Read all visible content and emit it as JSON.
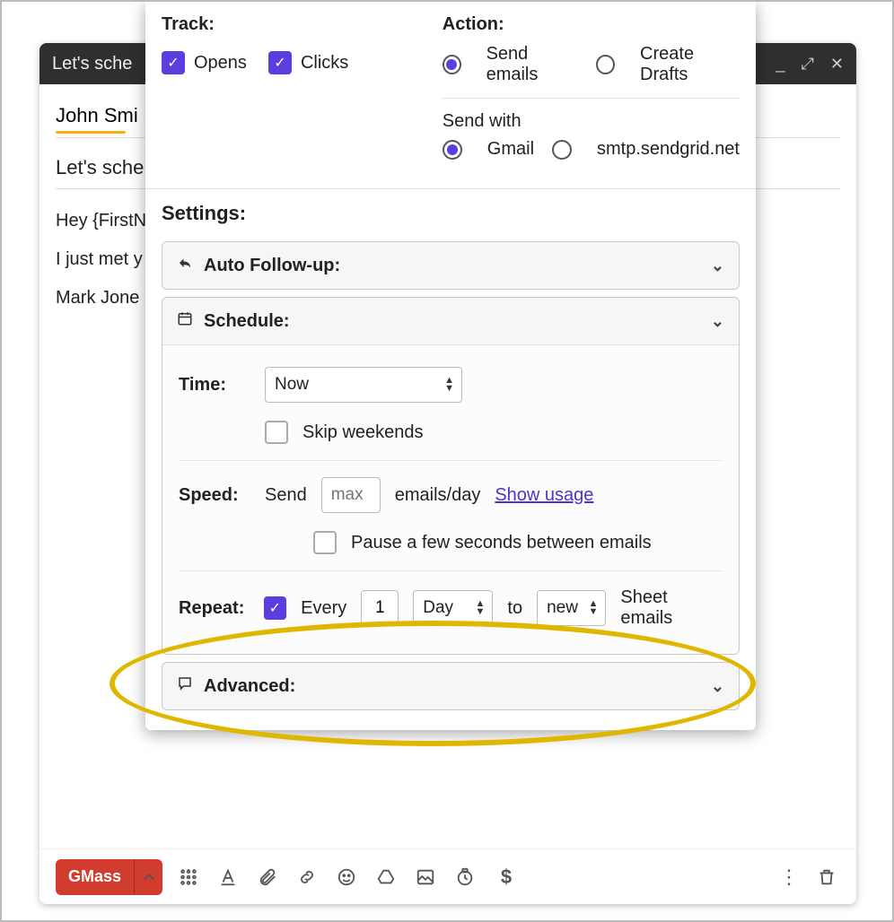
{
  "compose": {
    "subject_title": "Let's sche",
    "recipient": "John Smi",
    "subject": "Let's sche",
    "body_line1": "Hey {FirstN",
    "body_line2": "I just met y",
    "body_line3": "Mark Jone"
  },
  "panel": {
    "track_label": "Track:",
    "track_opens": "Opens",
    "track_clicks": "Clicks",
    "action_label": "Action:",
    "action_send": "Send emails",
    "action_drafts": "Create Drafts",
    "sendwith_label": "Send with",
    "sendwith_gmail": "Gmail",
    "sendwith_smtp": "smtp.sendgrid.net",
    "settings_title": "Settings:",
    "autofollowup_title": "Auto Follow-up:",
    "schedule_title": "Schedule:",
    "time_label": "Time:",
    "time_value": "Now",
    "skip_weekends": "Skip weekends",
    "speed_label": "Speed:",
    "speed_send": "Send",
    "speed_placeholder": "max",
    "speed_suffix": "emails/day",
    "show_usage": "Show usage",
    "pause_label": "Pause a few seconds between emails",
    "repeat_label": "Repeat:",
    "repeat_every": "Every",
    "repeat_num": "1",
    "repeat_unit": "Day",
    "repeat_to": "to",
    "repeat_scope": "new",
    "repeat_suffix": "Sheet emails",
    "advanced_title": "Advanced:"
  },
  "toolbar": {
    "gmass_label": "GMass"
  }
}
